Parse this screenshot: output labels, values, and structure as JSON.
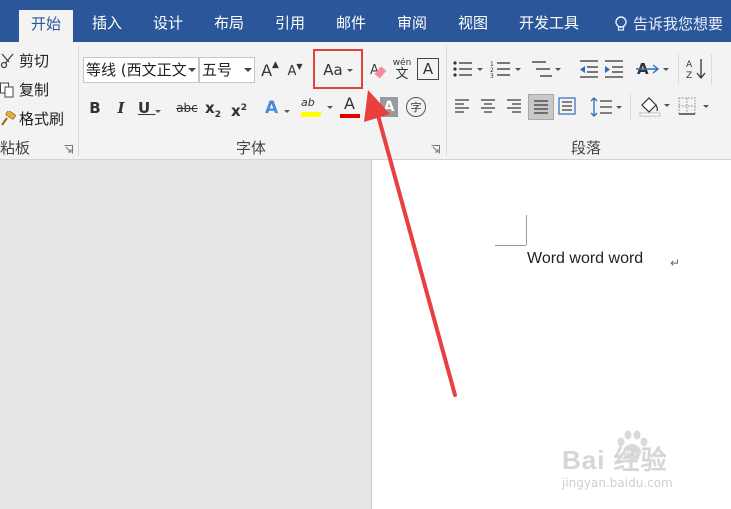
{
  "tabs": [
    {
      "label": "开始",
      "active": true
    },
    {
      "label": "插入"
    },
    {
      "label": "设计"
    },
    {
      "label": "布局"
    },
    {
      "label": "引用"
    },
    {
      "label": "邮件"
    },
    {
      "label": "审阅"
    },
    {
      "label": "视图"
    },
    {
      "label": "开发工具"
    }
  ],
  "tell_me": "告诉我您想要",
  "clipboard": {
    "cut": "剪切",
    "copy": "复制",
    "format_painter": "格式刷",
    "group_label": "粘板"
  },
  "font": {
    "name": "等线 (西文正文",
    "size": "五号",
    "grow_label": "A",
    "shrink_label": "A",
    "change_case_label": "Aa",
    "phonetic_top": "wén",
    "phonetic_bottom": "文",
    "border_label": "A",
    "bold": "B",
    "italic": "I",
    "underline": "U",
    "strike": "abc",
    "sub": "x",
    "sub_mark": "2",
    "sup": "x",
    "sup_mark": "2",
    "effects_label": "A",
    "highlight_label": "ab",
    "color_label": "A",
    "shading_label": "A",
    "enclose_label": "字",
    "group_label": "字体"
  },
  "paragraph": {
    "group_label": "段落"
  },
  "colors": {
    "tab_bar": "#2b579a",
    "highlight_yellow": "#ffff00",
    "font_red": "#e00000",
    "annotation_red": "#e04040"
  },
  "document": {
    "text": "Word word word",
    "paragraph_mark": "↵"
  },
  "watermark": {
    "main": "Bai 经验",
    "du": "du",
    "sub": "jingyan.baidu.com"
  }
}
